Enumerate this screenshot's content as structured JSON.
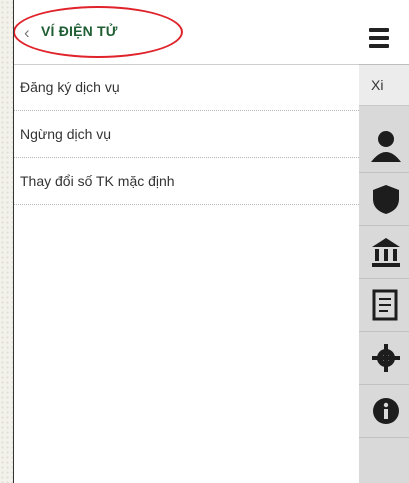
{
  "header": {
    "back_icon": "chevron-left",
    "title": "VÍ ĐIỆN TỬ"
  },
  "menu": {
    "items": [
      {
        "label": "Đăng ký dịch vụ"
      },
      {
        "label": "Ngừng dịch vụ"
      },
      {
        "label": "Thay đổi số TK mặc định"
      }
    ]
  },
  "side_panel": {
    "sub_text": "Xi",
    "icons": [
      "user-icon",
      "shield-icon",
      "bank-icon",
      "document-icon",
      "gear-icon",
      "info-icon"
    ]
  },
  "colors": {
    "title": "#1f5e33",
    "highlight": "#e0232a"
  }
}
